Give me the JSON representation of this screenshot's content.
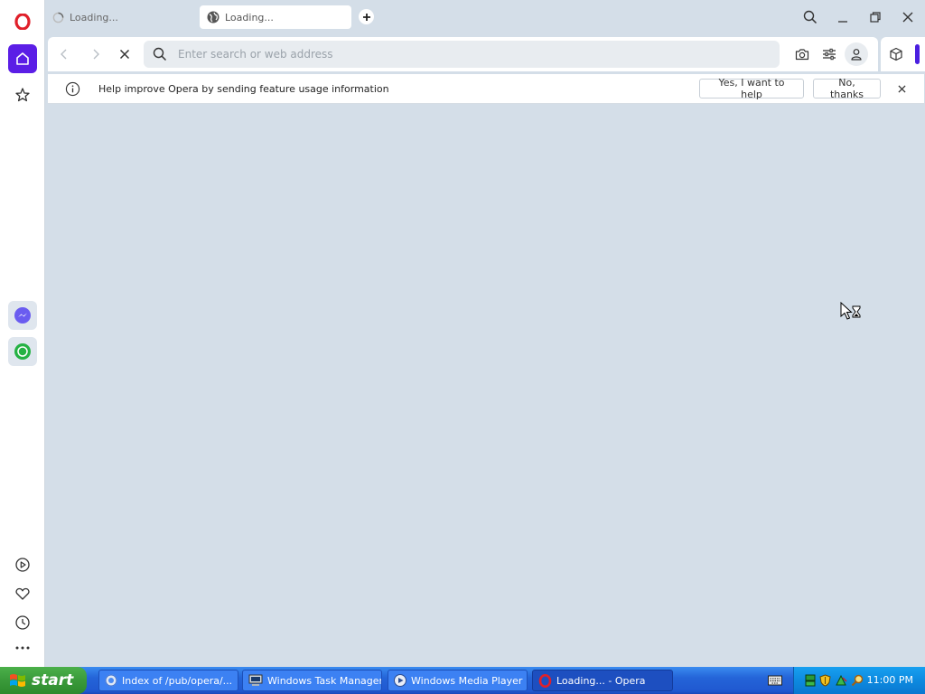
{
  "browser": {
    "tabs": [
      {
        "label": "Loading..."
      },
      {
        "label": "Loading..."
      }
    ],
    "address_bar": {
      "placeholder": "Enter search or web address",
      "value": ""
    },
    "infobar": {
      "message": "Help improve Opera by sending feature usage information",
      "accept_label": "Yes, I want to help",
      "decline_label": "No, thanks"
    }
  },
  "taskbar": {
    "start_label": "start",
    "tasks": [
      {
        "label": "Index of /pub/opera/...",
        "icon": "chrome-icon"
      },
      {
        "label": "Windows Task Manager",
        "icon": "task-manager-icon"
      },
      {
        "label": "Windows Media Player",
        "icon": "media-player-icon"
      },
      {
        "label": "Loading... - Opera",
        "icon": "opera-icon",
        "active": true
      }
    ],
    "clock": "11:00 PM"
  },
  "colors": {
    "accent": "#5b1ee6",
    "opera_red": "#e0202a",
    "content_bg": "#d4dee8",
    "taskbar_blue": "#2464d8",
    "start_green": "#3a9a3a"
  }
}
